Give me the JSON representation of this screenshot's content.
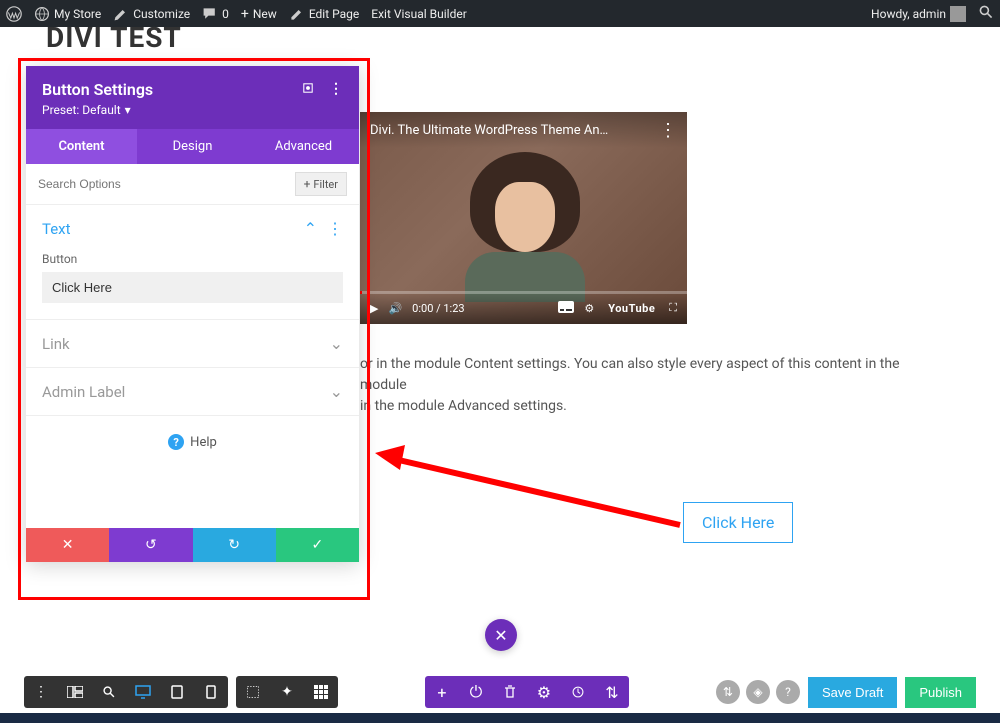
{
  "admin_bar": {
    "store": "My Store",
    "customize": "Customize",
    "comments": "0",
    "new": "New",
    "edit_page": "Edit Page",
    "exit_vb": "Exit Visual Builder",
    "howdy": "Howdy, admin"
  },
  "page_title": "DIVI TEST",
  "panel": {
    "title": "Button Settings",
    "preset_label": "Preset: Default",
    "tabs": {
      "content": "Content",
      "design": "Design",
      "advanced": "Advanced"
    },
    "search_placeholder": "Search Options",
    "filter_label": "Filter",
    "sections": {
      "text": {
        "title": "Text",
        "field_label": "Button",
        "field_value": "Click Here"
      },
      "link": {
        "title": "Link"
      },
      "admin_label": {
        "title": "Admin Label"
      }
    },
    "help": "Help"
  },
  "video": {
    "title": "Divi. The Ultimate WordPress Theme An…",
    "time": "0:00 / 1:23",
    "youtube": "YouTube"
  },
  "body_text": {
    "line1": "or in the module Content settings. You can also style every aspect of this content in the module",
    "line2": "in the module Advanced settings."
  },
  "click_here": "Click Here",
  "bottom": {
    "save_draft": "Save Draft",
    "publish": "Publish"
  }
}
